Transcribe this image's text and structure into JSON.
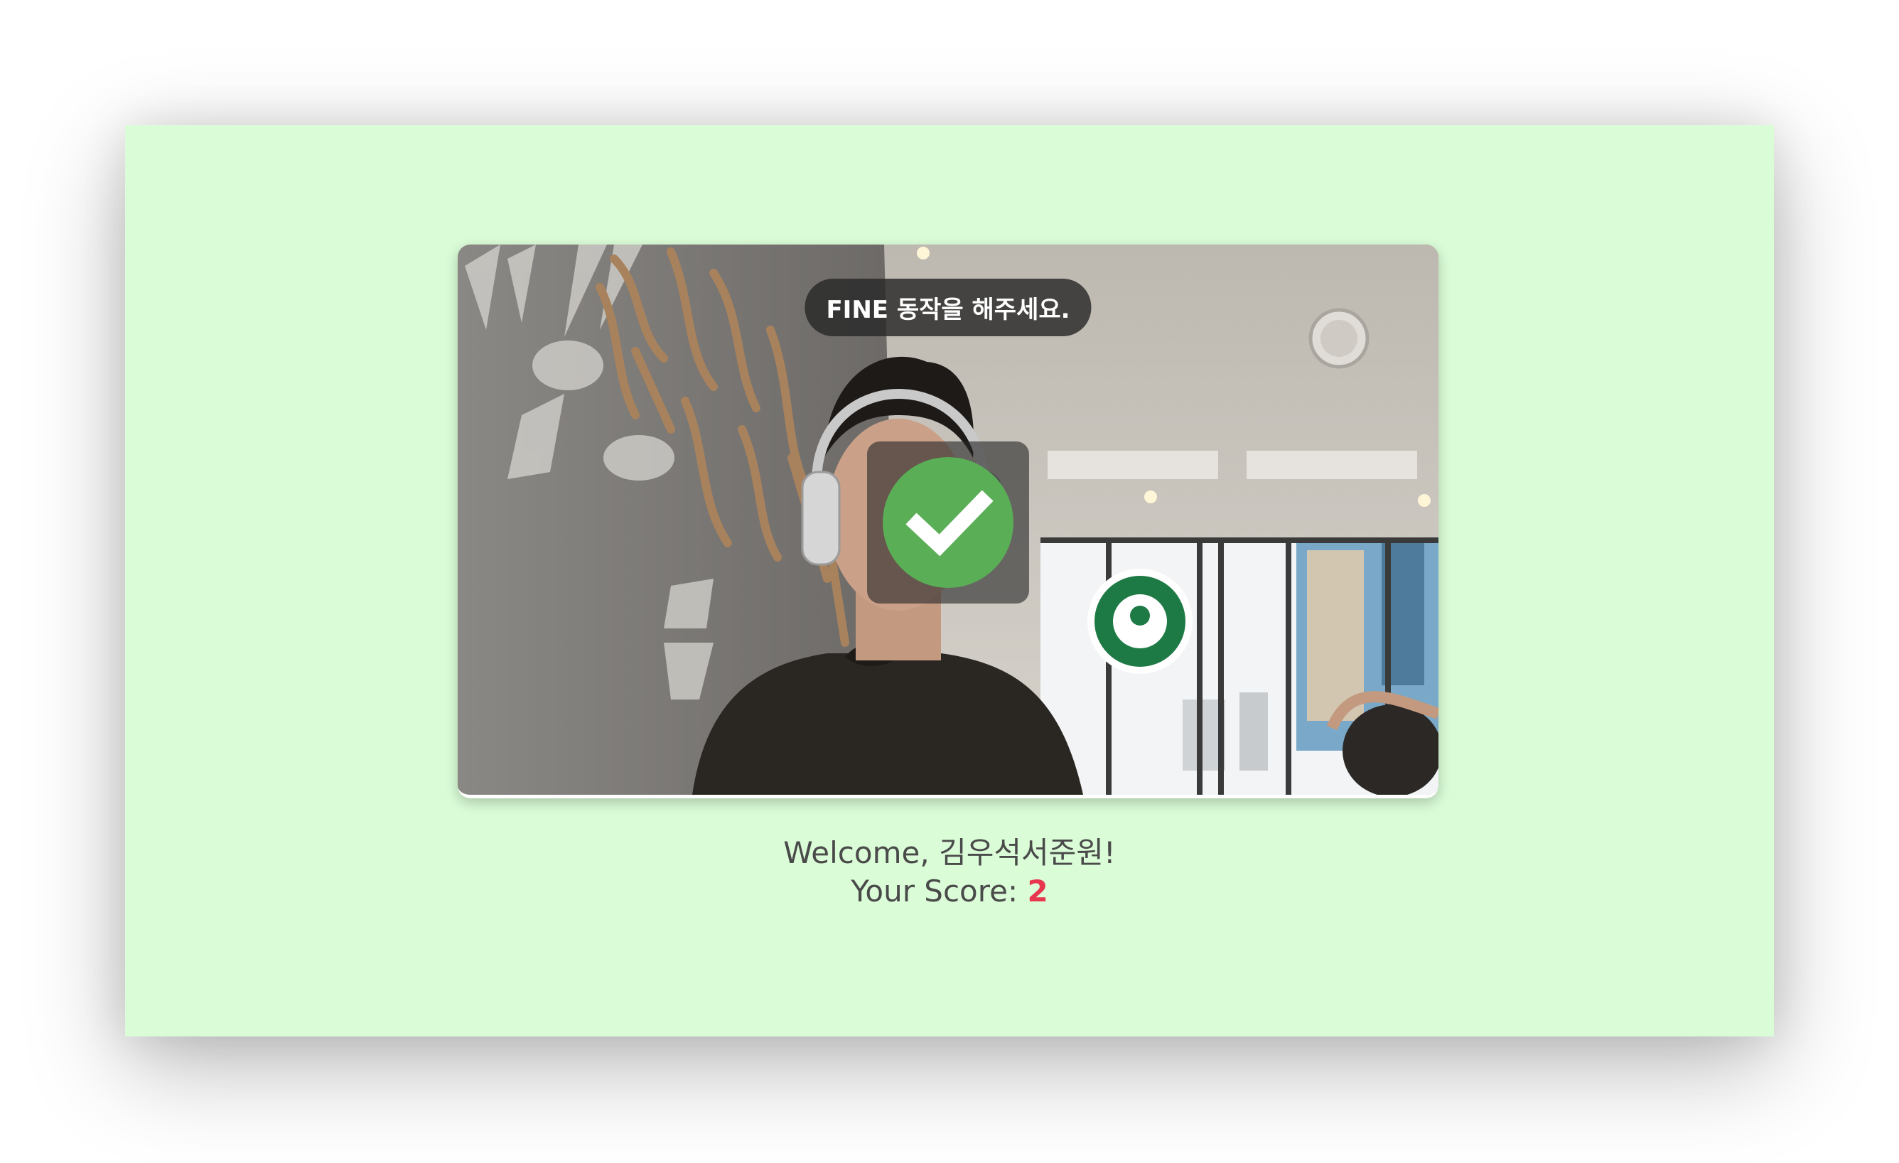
{
  "webcam": {
    "instruction": "FINE 동작을 해주세요.",
    "status_icon": "check-icon",
    "status_color": "#5aae56"
  },
  "welcome": {
    "prefix": "Welcome, ",
    "name": "김우석서준원",
    "suffix": "!"
  },
  "score": {
    "label": "Your Score: ",
    "value": "2",
    "value_color": "#e8364f"
  },
  "colors": {
    "page_background": "#dafcd7"
  }
}
